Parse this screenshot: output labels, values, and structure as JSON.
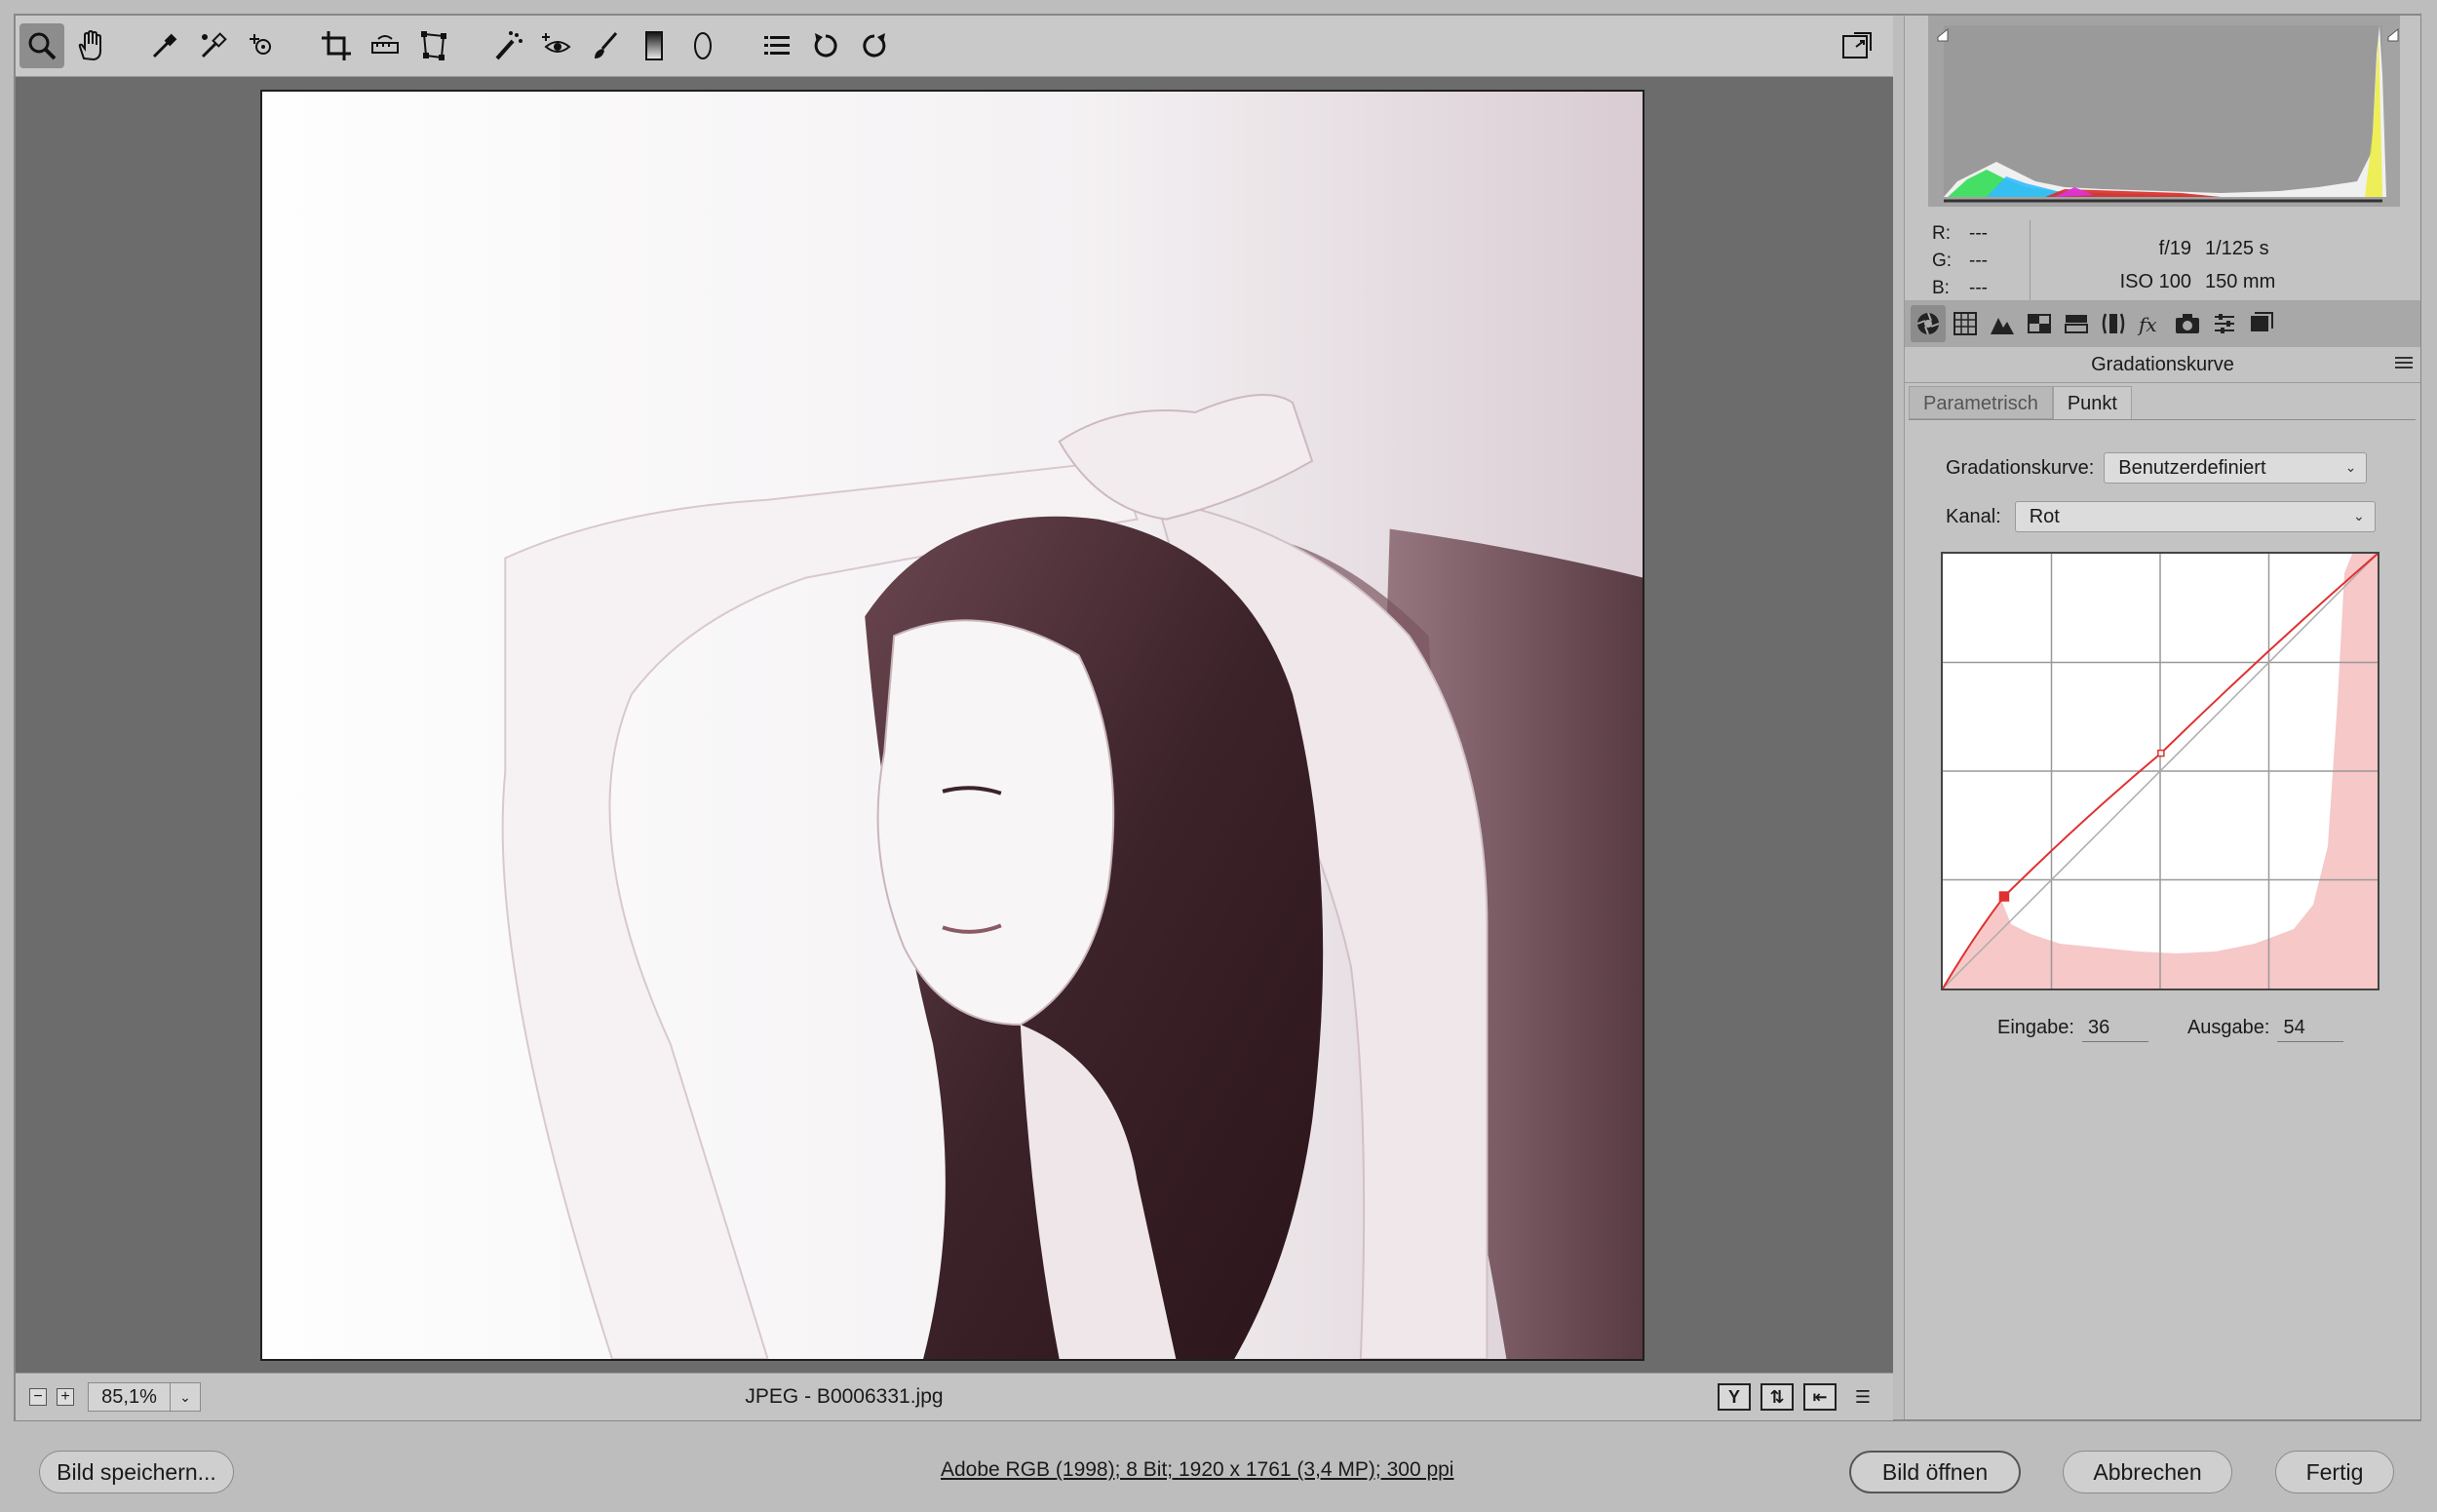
{
  "toolbar": {
    "tools": [
      "zoom-tool",
      "hand-tool",
      "white-balance-tool",
      "color-sampler-tool",
      "targeted-adjustment-tool",
      "crop-tool",
      "straighten-tool",
      "transform-tool",
      "spot-removal-tool",
      "red-eye-tool",
      "adjustment-brush-tool",
      "graduated-filter-tool",
      "radial-filter-tool",
      "preferences-tool",
      "rotate-left-tool",
      "rotate-right-tool"
    ],
    "exit_icon": "toggle-fullscreen-icon"
  },
  "status": {
    "zoom": "85,1%",
    "filename": "JPEG - B0006331.jpg"
  },
  "histogram": {
    "r_label": "R:",
    "r_value": "---",
    "g_label": "G:",
    "g_value": "---",
    "b_label": "B:",
    "b_value": "---",
    "aperture": "f/19",
    "shutter": "1/125 s",
    "iso": "ISO 100",
    "focal": "150 mm"
  },
  "panel": {
    "section_title": "Gradationskurve",
    "subtabs": [
      "Parametrisch",
      "Punkt"
    ],
    "curve_label": "Gradationskurve:",
    "curve_value": "Benutzerdefiniert",
    "channel_label": "Kanal:",
    "channel_value": "Rot",
    "input_label": "Eingabe:",
    "input_value": "36",
    "output_label": "Ausgabe:",
    "output_value": "54",
    "curve_points": [
      [
        0,
        0
      ],
      [
        36,
        54
      ],
      [
        128,
        138
      ],
      [
        255,
        255
      ]
    ],
    "curve_color": "#e03030"
  },
  "bottom": {
    "save_label": "Bild speichern...",
    "color_info": "Adobe RGB (1998); 8 Bit; 1920 x 1761 (3,4 MP); 300 ppi",
    "open_label": "Bild öffnen",
    "cancel_label": "Abbrechen",
    "done_label": "Fertig"
  }
}
